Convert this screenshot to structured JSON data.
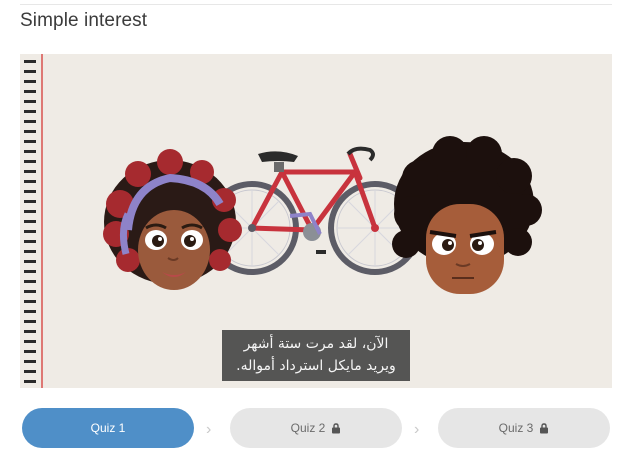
{
  "header": {
    "title": "Simple interest"
  },
  "video": {
    "subtitle_line1": "الآن، لقد مرت ستة أشهر",
    "subtitle_line2": "ويريد مايكل استرداد أمواله."
  },
  "quizzes": [
    {
      "label": "Quiz 1",
      "locked": false,
      "active": true
    },
    {
      "label": "Quiz 2",
      "locked": true,
      "active": false
    },
    {
      "label": "Quiz 3",
      "locked": true,
      "active": false
    }
  ],
  "colors": {
    "active_quiz": "#4f8fc8",
    "locked_quiz": "#e6e6e6",
    "video_background": "#efebe5"
  },
  "icons": {
    "locked": "lock-icon",
    "separator": "chevron-right-icon"
  }
}
